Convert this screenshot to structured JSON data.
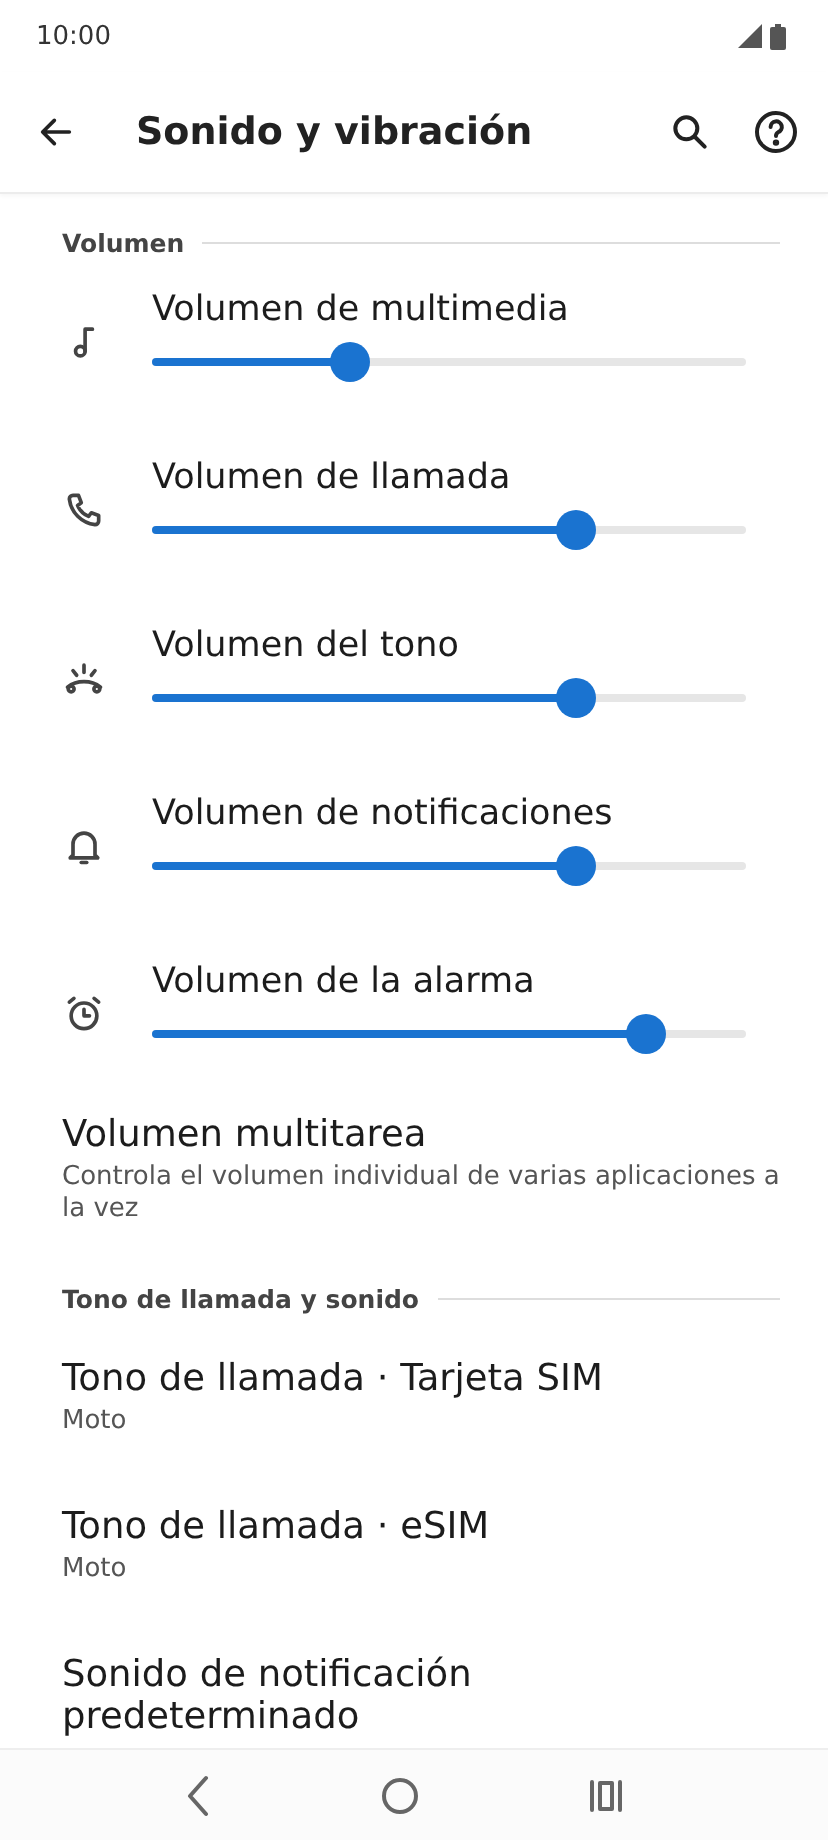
{
  "status_bar": {
    "time": "10:00"
  },
  "app_bar": {
    "title": "Sonido y vibración"
  },
  "sections": [
    {
      "header": "Volumen",
      "items": [
        {
          "kind": "slider",
          "title": "Volumen de multimedia",
          "level": 0.333
        },
        {
          "kind": "slider",
          "title": "Volumen de llamada",
          "level": 0.714
        },
        {
          "kind": "slider",
          "title": "Volumen del tono",
          "level": 0.714
        },
        {
          "kind": "slider",
          "title": "Volumen de notificaciones",
          "level": 0.714
        },
        {
          "kind": "slider",
          "title": "Volumen de la alarma",
          "level": 0.833
        },
        {
          "kind": "text",
          "title": "Volumen multitarea",
          "subtitle": "Controla el volumen individual de varias aplicaciones a la vez"
        }
      ]
    },
    {
      "header": "Tono de llamada y sonido",
      "items": [
        {
          "kind": "text",
          "title": "Tono de llamada · Tarjeta SIM",
          "subtitle": "Moto"
        },
        {
          "kind": "text",
          "title": "Tono de llamada · eSIM",
          "subtitle": "Moto"
        },
        {
          "kind": "text",
          "title": "Sonido de notificación predeterminado"
        }
      ]
    }
  ]
}
